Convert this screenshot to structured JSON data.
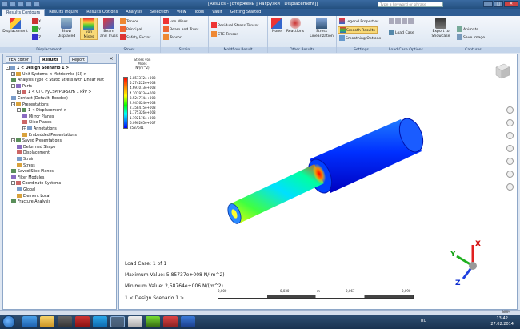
{
  "window": {
    "title": "[Results - [стержень ] нагрузки : Displacement]]",
    "search_placeholder": "Type a keyword or phrase",
    "buttons": [
      "_",
      "□",
      "✕"
    ]
  },
  "ribbon_tabs": [
    {
      "label": "Results Contours",
      "active": true
    },
    {
      "label": "Results Inquire",
      "active": false
    },
    {
      "label": "Results Options",
      "active": false
    },
    {
      "label": "Analysis",
      "active": false
    },
    {
      "label": "Selection",
      "active": false
    },
    {
      "label": "View",
      "active": false
    },
    {
      "label": "Tools",
      "active": false
    },
    {
      "label": "Vault",
      "active": false
    },
    {
      "label": "Getting Started",
      "active": false
    }
  ],
  "ribbon": {
    "displacement": {
      "main": "Displacement",
      "x": "X",
      "y": "Y",
      "z": "Z",
      "show": "Show Displaced",
      "group": "Displacement"
    },
    "stress": {
      "von_mises": "von Mises",
      "beam_truss": "Beam and Truss",
      "tensor": "Tensor",
      "principal": "Principal",
      "safety": "Safety Factor",
      "group": "Stress"
    },
    "strain": {
      "von_mises": "von Mises",
      "beam_truss": "Beam and Truss",
      "tensor": "Tensor",
      "group": "Strain"
    },
    "moldflow": {
      "residual": "Residual Stress Tensor",
      "cte": "CTE Tensor",
      "group": "Moldflow Result"
    },
    "other": {
      "none": "None",
      "reactions": "Reactions",
      "linearization": "Stress Linearization",
      "group": "Other Results"
    },
    "settings": {
      "legend": "Legend Properties",
      "smooth": "Smooth Results",
      "smoothing": "Smoothing Options",
      "group": "Settings"
    },
    "loadcase": {
      "label": "Load Case",
      "group": "Load Case Options"
    },
    "captures": {
      "export": "Export to Showcase",
      "animate": "Animate",
      "save_image": "Save Image",
      "group": "Captures"
    }
  },
  "left_panel": {
    "tabs": [
      "FEA Editor",
      "Results",
      "Report"
    ],
    "active_tab": "Results",
    "tree": [
      {
        "indent": 0,
        "toggle": "-",
        "label": "1 < Design Scenario 1 >",
        "bold": true
      },
      {
        "indent": 1,
        "toggle": "+",
        "label": "Unit Systems < Metric mks (SI) >"
      },
      {
        "indent": 1,
        "toggle": "",
        "label": "Analysis Type < Static Stress with Linear Mat"
      },
      {
        "indent": 1,
        "toggle": "-",
        "label": "Parts"
      },
      {
        "indent": 2,
        "toggle": "+",
        "label": "1 < СГС РуСЅРґРµРЅСЊ 1 РЎР >"
      },
      {
        "indent": 1,
        "toggle": "",
        "label": "Contact (Default: Bonded)"
      },
      {
        "indent": 1,
        "toggle": "-",
        "label": "Presentations"
      },
      {
        "indent": 2,
        "toggle": "-",
        "label": "1 < Displacement >"
      },
      {
        "indent": 3,
        "toggle": "",
        "label": "Mirror Planes"
      },
      {
        "indent": 3,
        "toggle": "",
        "label": "Slice Planes"
      },
      {
        "indent": 3,
        "toggle": "+",
        "label": "Annotations"
      },
      {
        "indent": 3,
        "toggle": "",
        "label": "Embedded Presentations"
      },
      {
        "indent": 1,
        "toggle": "-",
        "label": "Saved Presentations"
      },
      {
        "indent": 2,
        "toggle": "",
        "label": "Deformed Shape"
      },
      {
        "indent": 2,
        "toggle": "",
        "label": "Displacement"
      },
      {
        "indent": 2,
        "toggle": "",
        "label": "Strain"
      },
      {
        "indent": 2,
        "toggle": "",
        "label": "Stress"
      },
      {
        "indent": 1,
        "toggle": "",
        "label": "Saved Slice Planes"
      },
      {
        "indent": 1,
        "toggle": "",
        "label": "Filter Modules"
      },
      {
        "indent": 1,
        "toggle": "-",
        "label": "Coordinate Systems"
      },
      {
        "indent": 2,
        "toggle": "",
        "label": "Global"
      },
      {
        "indent": 2,
        "toggle": "",
        "label": "Element Local"
      },
      {
        "indent": 1,
        "toggle": "",
        "label": "Fracture Analysis"
      }
    ]
  },
  "legend": {
    "title": "Stress von Mises N/(m^2)",
    "values": [
      "5.857372e+008",
      "5.274222e+008",
      "4.691073e+008",
      "4.107923e+008",
      "3.524774e+008",
      "2.941624e+008",
      "2.358475e+008",
      "1.775326e+008",
      "1.192176e+008",
      "6.090265e+007",
      "2587641"
    ],
    "colors": {
      "max": "#ff0000",
      "mid": "#00ff00",
      "min": "#0000ff"
    }
  },
  "info": {
    "load_case": "Load Case:   1 of 1",
    "maximum": "Maximum Value:  5,85737e+008 N/(m^2)",
    "minimum": "Minimum Value:  2,58764e+006 N/(m^2)",
    "scenario": "1 < Design Scenario 1 >"
  },
  "scale": {
    "ticks": [
      "0,000",
      "0,030",
      "m",
      "0,067",
      "0,090"
    ]
  },
  "axes": {
    "x": "X",
    "y": "Y",
    "z": "Z"
  },
  "statusbar": {
    "num": "NUM"
  },
  "taskbar": {
    "lang": "RU",
    "time": "13:42",
    "date": "27.02.2014"
  }
}
